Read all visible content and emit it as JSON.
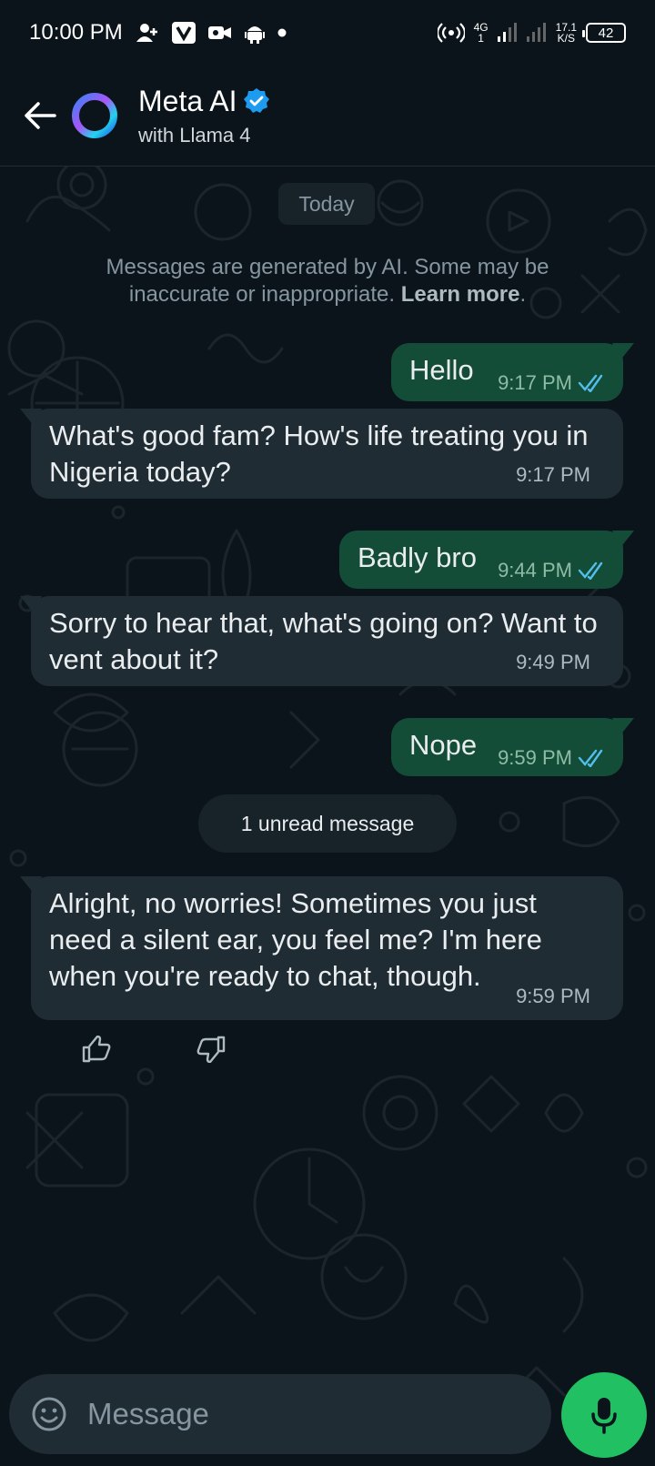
{
  "status_bar": {
    "time": "10:00 PM",
    "network_type": "4G",
    "network_sub": "1",
    "speed_value": "17.1",
    "speed_unit": "K/S",
    "battery": "42"
  },
  "header": {
    "title": "Meta AI",
    "subtitle": "with Llama 4",
    "verified": true
  },
  "chat": {
    "date_chip": "Today",
    "ai_notice": "Messages are generated by AI. Some may be inaccurate or inappropriate.",
    "learn_more": "Learn more",
    "learn_more_suffix": ".",
    "messages": [
      {
        "direction": "out",
        "text": "Hello",
        "time": "9:17 PM",
        "read": true
      },
      {
        "direction": "in",
        "text": "What's good fam? How's life treating you in Nigeria today?",
        "time": "9:17 PM"
      },
      {
        "direction": "out",
        "text": "Badly bro",
        "time": "9:44 PM",
        "read": true
      },
      {
        "direction": "in",
        "text": "Sorry to hear that, what's going on? Want to vent about it?",
        "time": "9:49 PM"
      },
      {
        "direction": "out",
        "text": "Nope",
        "time": "9:59 PM",
        "read": true
      },
      {
        "direction": "in",
        "text": "Alright, no worries! Sometimes you just need a silent ear, you feel me? I'm here when you're ready to chat, though.",
        "time": "9:59 PM"
      }
    ],
    "unread_label": "1 unread message"
  },
  "composer": {
    "placeholder": "Message"
  },
  "colors": {
    "background": "#0b141a",
    "outgoing_bubble": "#144d37",
    "incoming_bubble": "#202c33",
    "accent_green": "#21c063",
    "read_ticks": "#53bdeb",
    "verified_badge": "#1d9bf0"
  },
  "icons": {
    "back": "arrow-left-icon",
    "avatar": "meta-ai-ring-icon",
    "verified": "verified-badge-icon",
    "read": "double-check-icon",
    "like": "thumbs-up-icon",
    "dislike": "thumbs-down-icon",
    "emoji": "emoji-icon",
    "mic": "microphone-icon"
  }
}
